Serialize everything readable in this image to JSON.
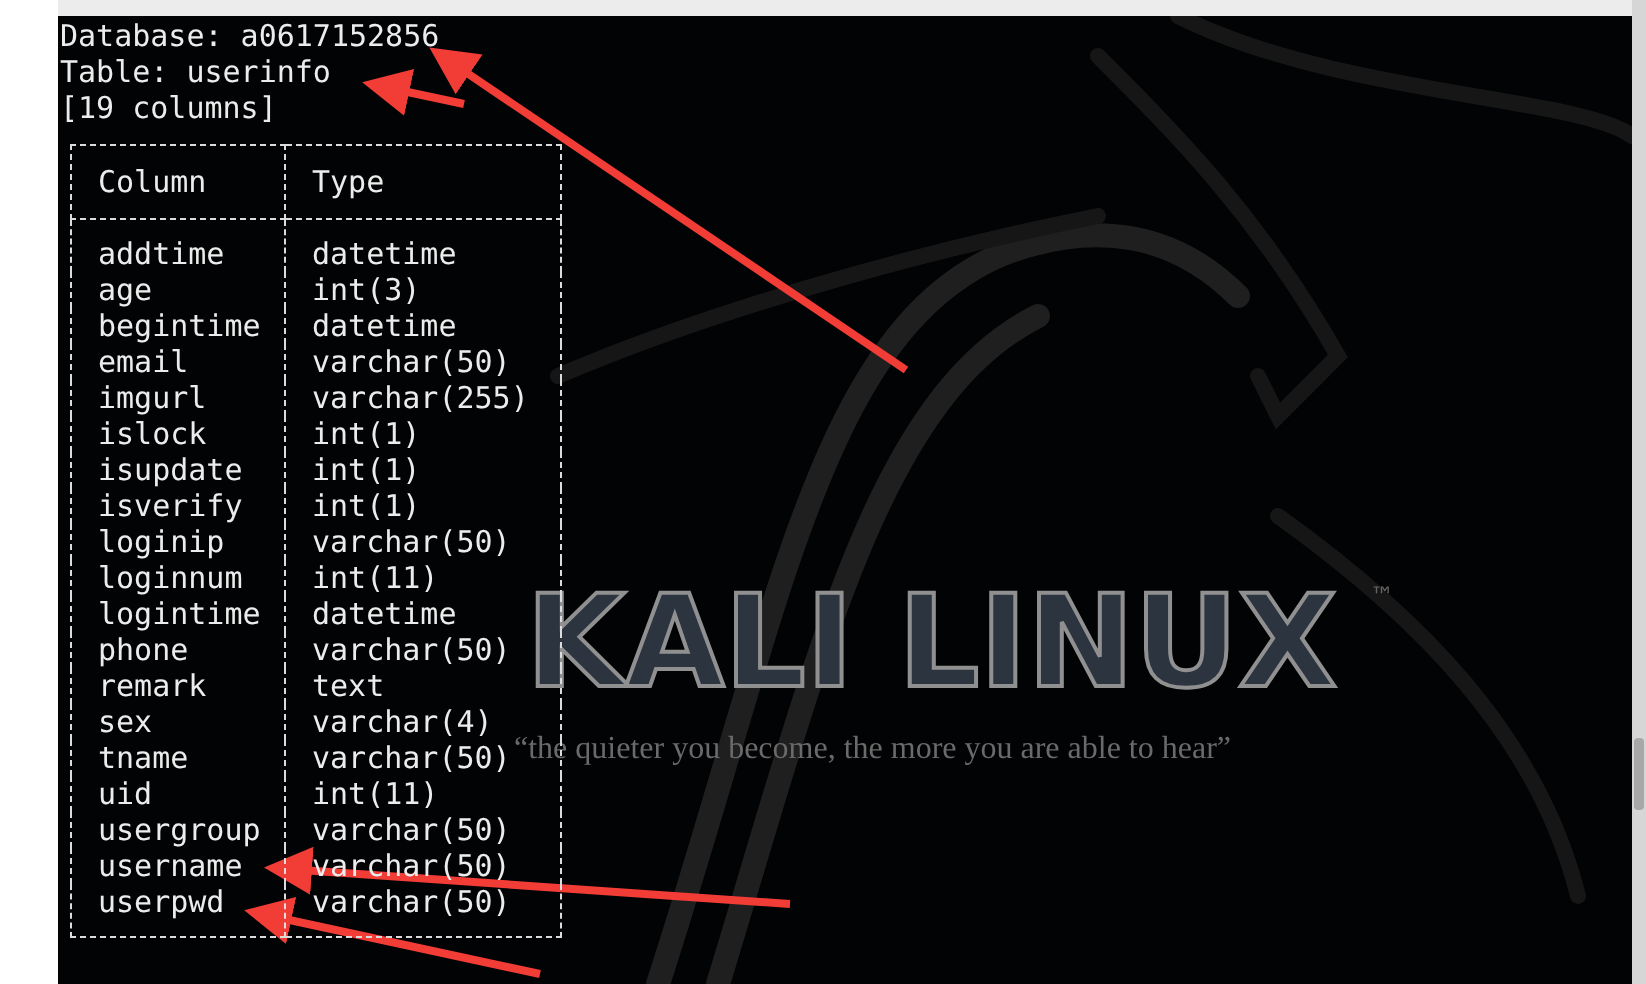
{
  "terminal": {
    "database_line": "Database: a0617152856",
    "table_line": "Table: userinfo",
    "count_line": "[19 columns]",
    "columns": [
      {
        "name": "Column",
        "type": "Type"
      }
    ],
    "rows": [
      {
        "name": "addtime",
        "type": "datetime"
      },
      {
        "name": "age",
        "type": "int(3)"
      },
      {
        "name": "begintime",
        "type": "datetime"
      },
      {
        "name": "email",
        "type": "varchar(50)"
      },
      {
        "name": "imgurl",
        "type": "varchar(255)"
      },
      {
        "name": "islock",
        "type": "int(1)"
      },
      {
        "name": "isupdate",
        "type": "int(1)"
      },
      {
        "name": "isverify",
        "type": "int(1)"
      },
      {
        "name": "loginip",
        "type": "varchar(50)"
      },
      {
        "name": "loginnum",
        "type": "int(11)"
      },
      {
        "name": "logintime",
        "type": "datetime"
      },
      {
        "name": "phone",
        "type": "varchar(50)"
      },
      {
        "name": "remark",
        "type": "text"
      },
      {
        "name": "sex",
        "type": "varchar(4)"
      },
      {
        "name": "tname",
        "type": "varchar(50)"
      },
      {
        "name": "uid",
        "type": "int(11)"
      },
      {
        "name": "usergroup",
        "type": "varchar(50)"
      },
      {
        "name": "username",
        "type": "varchar(50)"
      },
      {
        "name": "userpwd",
        "type": "varchar(50)"
      }
    ]
  },
  "wallpaper": {
    "logo": "KALI LINUX",
    "trademark": "™",
    "tagline": "“the quieter you become, the more you are able to hear”"
  }
}
